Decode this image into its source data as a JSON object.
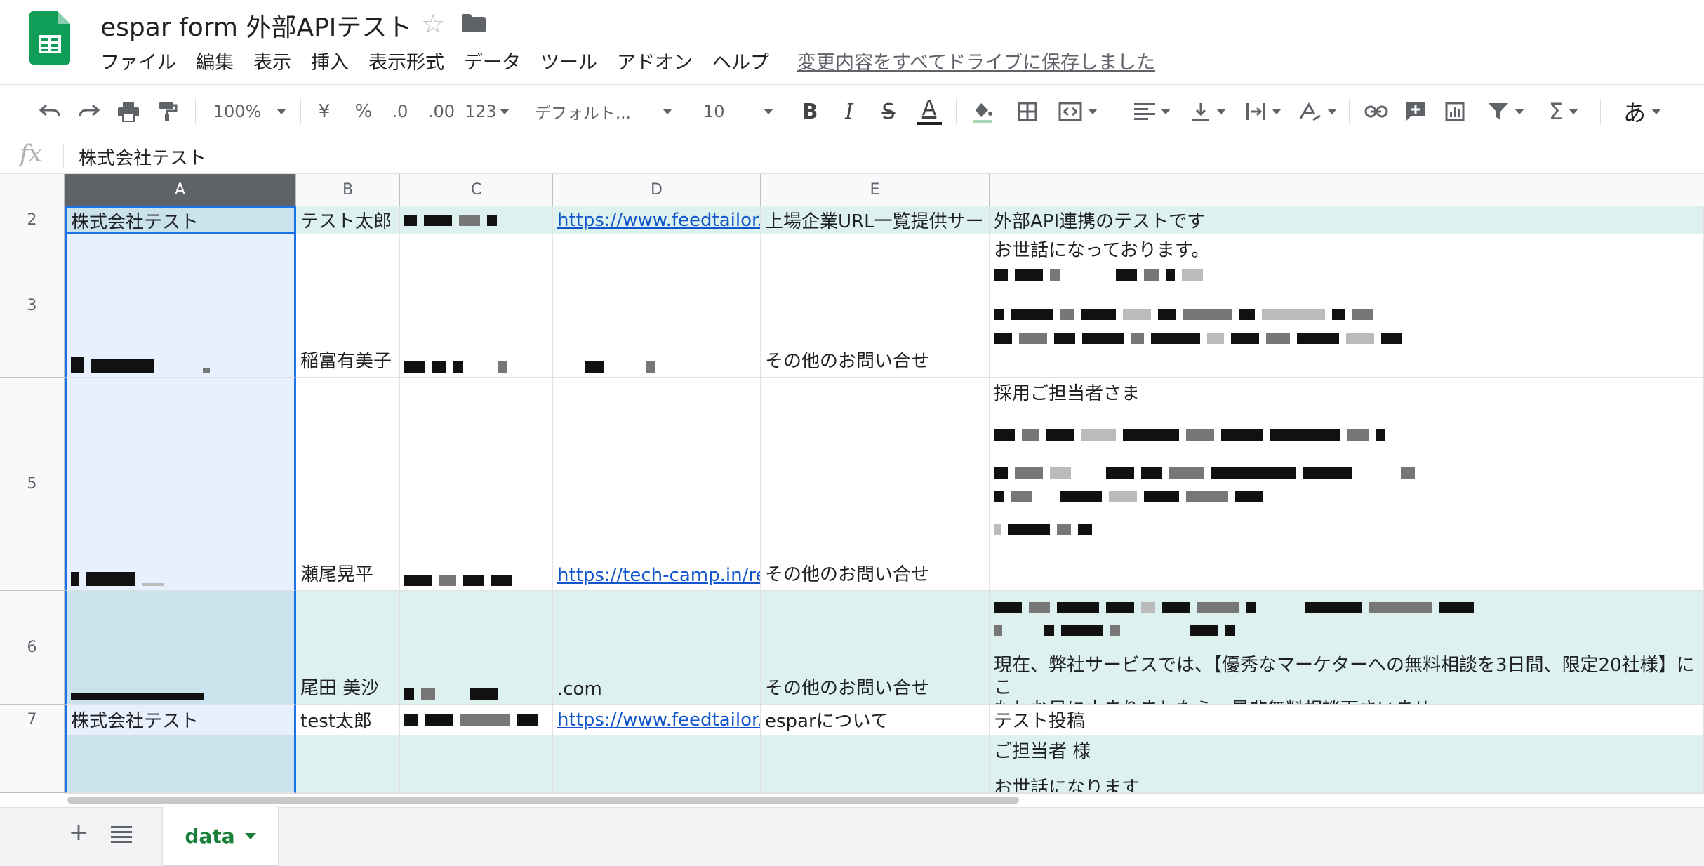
{
  "doc": {
    "title": "espar form 外部APIテスト",
    "save_status": "変更内容をすべてドライブに保存しました"
  },
  "menu": [
    "ファイル",
    "編集",
    "表示",
    "挿入",
    "表示形式",
    "データ",
    "ツール",
    "アドオン",
    "ヘルプ"
  ],
  "toolbar": {
    "zoom": "100%",
    "currency": "¥",
    "percent": "%",
    "decimal_decrease": ".0",
    "decimal_increase": ".00",
    "more_formats": "123",
    "font": "デフォルト...",
    "font_size": "10",
    "bold": "B",
    "italic": "I",
    "strikethrough": "S",
    "text_color": "A",
    "input_tools": "あ"
  },
  "formula_bar": {
    "fx": "fx",
    "value": "株式会社テスト"
  },
  "columns": [
    "A",
    "B",
    "C",
    "D",
    "E"
  ],
  "rows": {
    "r2": {
      "num": "2",
      "a": "株式会社テスト",
      "b": "テスト太郎",
      "d": "https://www.feedtailor.jp/",
      "e": "上場企業URL一覧提供サー",
      "f": "外部API連携のテストです"
    },
    "r3": {
      "num": "3",
      "b": "稲富有美子",
      "e": "その他のお問い合せ",
      "f": "お世話になっております。"
    },
    "r5": {
      "num": "5",
      "b": "瀬尾晃平",
      "d": "https://tech-camp.in/recru",
      "e": "その他のお問い合せ",
      "f": "採用ご担当者さま"
    },
    "r6": {
      "num": "6",
      "b": "尾田 美沙",
      "d": ".com",
      "e": "その他のお問い合せ",
      "f_line1": "現在、弊社サービスでは、【優秀なマーケターへの無料相談を3日間、限定20社様】にこ",
      "f_line2": "もしお目に止まりましたら、是非無料相談下さいませ。"
    },
    "r7": {
      "num": "7",
      "a": "株式会社テスト",
      "b": "test太郎",
      "d": "https://www.feedtailor.jp/",
      "e": "esparについて",
      "f": "テスト投稿"
    },
    "r8": {
      "f_line1": "ご担当者 様",
      "f_line2": "お世話になります"
    }
  },
  "sheet_tab": {
    "label": "data"
  },
  "colors": {
    "accent_green": "#188038",
    "selection_blue": "#1a73e8",
    "row_band_teal": "#ddf1ee",
    "link": "#1155cc"
  },
  "icons": [
    "sheets-logo-icon",
    "star-icon",
    "folder-icon",
    "undo-icon",
    "redo-icon",
    "print-icon",
    "paint-format-icon",
    "fill-color-icon",
    "borders-icon",
    "merge-cells-icon",
    "align-left-icon",
    "valign-bottom-icon",
    "text-wrap-icon",
    "text-rotate-icon",
    "link-icon",
    "comment-icon",
    "chart-icon",
    "filter-icon",
    "functions-icon",
    "add-sheet-icon",
    "all-sheets-icon"
  ]
}
